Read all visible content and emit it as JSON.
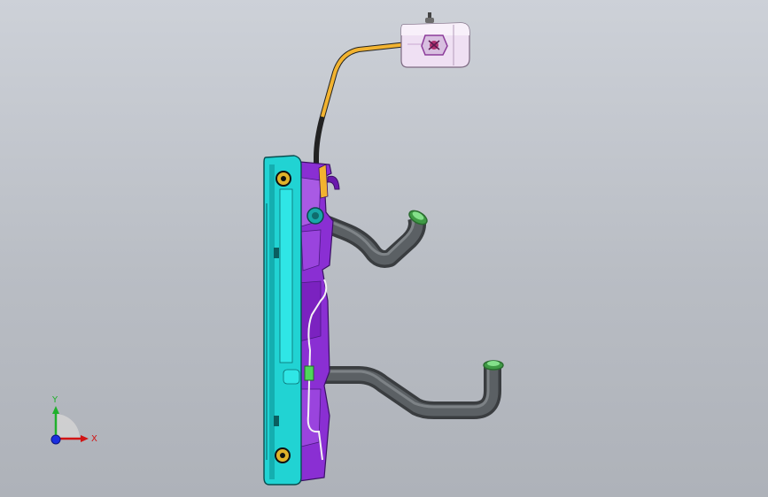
{
  "viewport": {
    "background_top": "#cdd1d8",
    "background_bottom": "#aeb2b9"
  },
  "model": {
    "parts": [
      {
        "name": "expansion-tank",
        "color": "#eedcf2"
      },
      {
        "name": "overflow-hose",
        "color": "#f5b83a"
      },
      {
        "name": "radiator-core",
        "color": "#1fd2d2"
      },
      {
        "name": "fan-shroud",
        "color": "#8a2fd3"
      },
      {
        "name": "upper-hose",
        "color": "#4e5256"
      },
      {
        "name": "lower-hose",
        "color": "#4e5256"
      },
      {
        "name": "hose-clamp",
        "color": "#4fd65a"
      }
    ]
  },
  "triad": {
    "x_label": "X",
    "y_label": "Y",
    "x_color": "#d11414",
    "y_color": "#1fb02c",
    "z_color": "#1a2ee0"
  }
}
